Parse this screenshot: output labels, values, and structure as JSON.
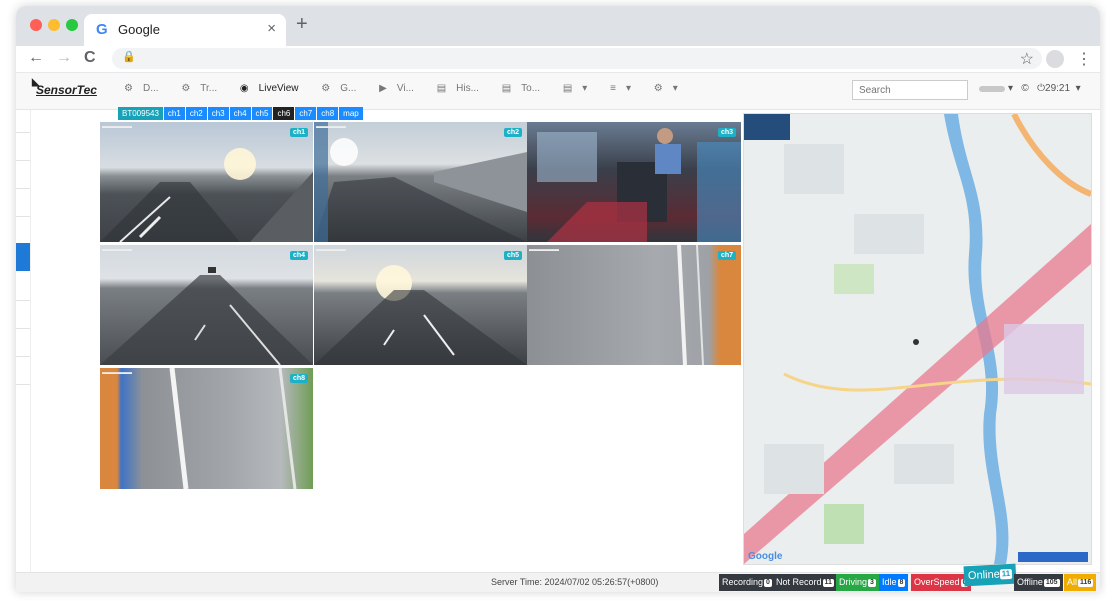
{
  "browser": {
    "tab_title": "Google",
    "tab_close": "×",
    "new_tab": "+",
    "back": "←",
    "forward": "→",
    "reload": "C",
    "lock": "🔒",
    "bookmark": "☆",
    "menu": "⋮"
  },
  "brand": {
    "logo": "SensorTec"
  },
  "nav": {
    "items": [
      "D...",
      "Tr...",
      "LiveView",
      "G...",
      "Vi...",
      "His...",
      "To...",
      "▾",
      "▾",
      "▾"
    ],
    "icons": [
      "dashboard-icon",
      "tracking-icon",
      "eye-icon",
      "group-icon",
      "video-icon",
      "history-icon",
      "tools-icon",
      "doc-icon",
      "list-icon",
      "gear-icon"
    ],
    "active_index": 2
  },
  "search": {
    "placeholder": "Search"
  },
  "header_right": {
    "user_caret": "▾",
    "copyright": "©",
    "timer": "29:21",
    "menu_caret": "▾"
  },
  "channel_tabs": [
    "BT009543",
    "ch1",
    "ch2",
    "ch3",
    "ch4",
    "ch5",
    "ch6",
    "ch7",
    "ch8",
    "map"
  ],
  "channel_active": "ch6",
  "cameras": [
    {
      "label": "ch1"
    },
    {
      "label": "ch2"
    },
    {
      "label": "ch3"
    },
    {
      "label": "ch4"
    },
    {
      "label": "ch5"
    },
    {
      "label": "ch7"
    },
    {
      "label": "ch8"
    }
  ],
  "status_bar": {
    "server_time": "Server Time: 2024/07/02 05:26:57(+0800)",
    "badges": [
      {
        "label": "Recording",
        "count": "0",
        "color": "#343a40"
      },
      {
        "label": "Not Record",
        "count": "11",
        "color": "#343a40"
      },
      {
        "label": "Driving",
        "count": "3",
        "color": "#28a745"
      },
      {
        "label": "Idle",
        "count": "8",
        "color": "#007bff"
      },
      {
        "label": "OverSpeed",
        "count": "0",
        "color": "#dc3545"
      },
      {
        "label": "Offline",
        "count": "105",
        "color": "#343a40"
      },
      {
        "label": "All",
        "count": "116",
        "color": "#f0ad00"
      }
    ],
    "online": {
      "label": "Online",
      "count": "11"
    }
  },
  "map_attribution": "Google"
}
